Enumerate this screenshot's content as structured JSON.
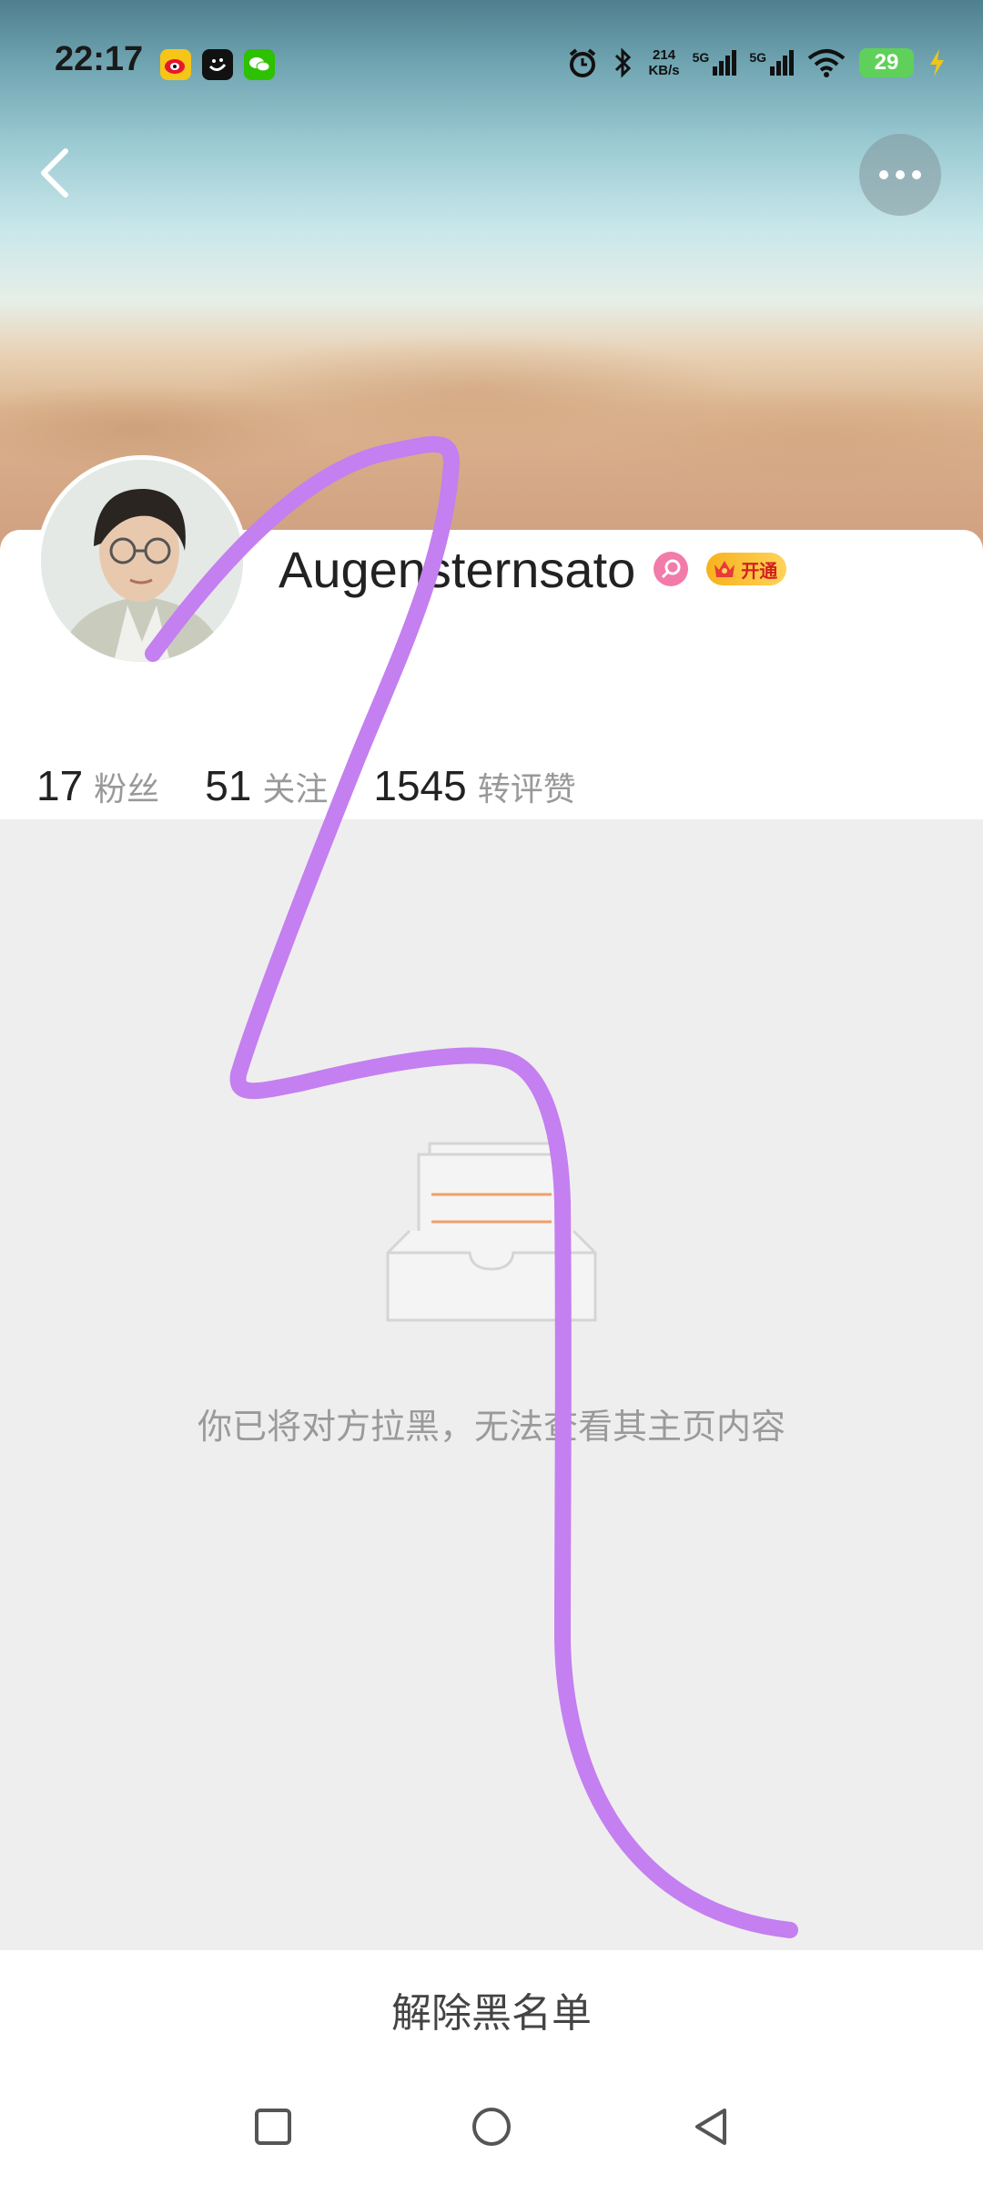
{
  "status_bar": {
    "time": "22:17",
    "network_speed_value": "214",
    "network_speed_unit": "KB/s",
    "sim1_label": "5G",
    "sim2_label": "5G",
    "battery_level": "29"
  },
  "profile": {
    "username": "Augensternsato",
    "vip_label": "开通",
    "stats": [
      {
        "num": "17",
        "label": "粉丝"
      },
      {
        "num": "51",
        "label": "关注"
      },
      {
        "num": "1545",
        "label": "转评赞"
      }
    ]
  },
  "content": {
    "blocked_message": "你已将对方拉黑，无法查看其主页内容"
  },
  "actions": {
    "unblock_label": "解除黑名单"
  },
  "colors": {
    "stroke": "#c47ff0",
    "empty_box_line": "#f0a06a"
  }
}
